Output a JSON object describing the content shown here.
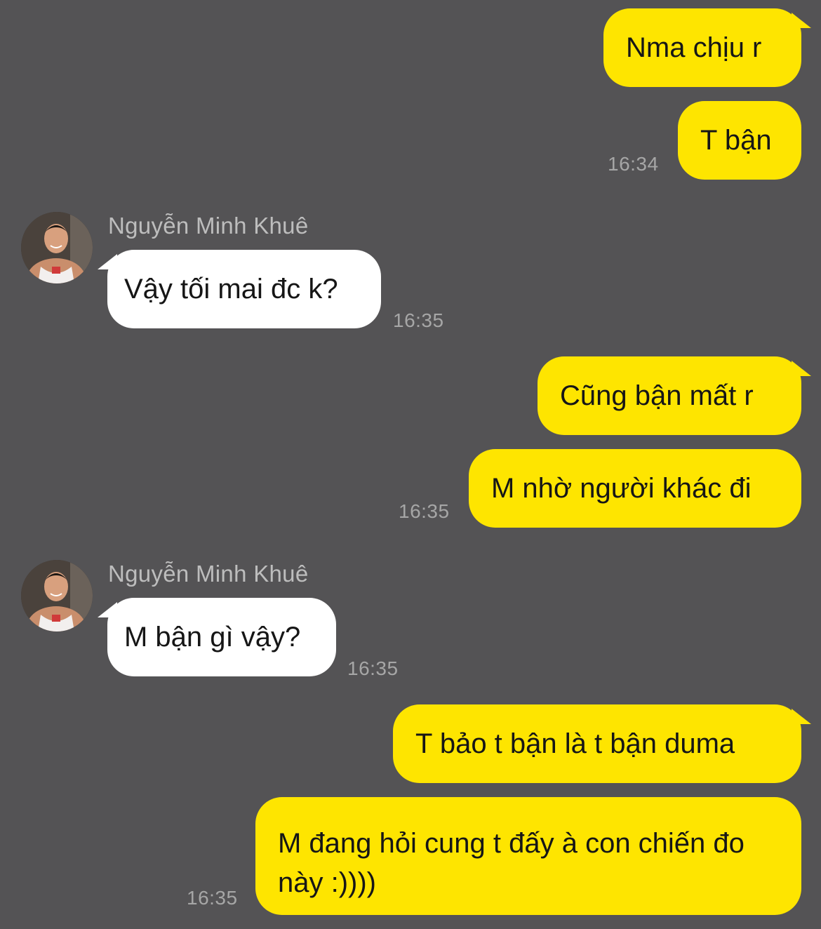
{
  "conversation": {
    "contact_name": "Nguyễn Minh Khuê",
    "avatar_icon": "person-photo-icon",
    "colors": {
      "background": "#545355",
      "outgoing_bubble": "#fee500",
      "incoming_bubble": "#ffffff",
      "timestamp": "#a6a6a6",
      "sender_name": "#bdbdbd"
    },
    "messages": [
      {
        "direction": "outgoing",
        "text": "Nma chịu r",
        "time": ""
      },
      {
        "direction": "outgoing",
        "text": "T bận",
        "time": "16:34"
      },
      {
        "direction": "incoming",
        "sender": "Nguyễn Minh Khuê",
        "text": "Vậy tối mai đc k?",
        "time": "16:35"
      },
      {
        "direction": "outgoing",
        "text": "Cũng bận mất r",
        "time": ""
      },
      {
        "direction": "outgoing",
        "text": "M nhờ người khác đi",
        "time": "16:35"
      },
      {
        "direction": "incoming",
        "sender": "Nguyễn Minh Khuê",
        "text": "M bận gì vậy?",
        "time": "16:35"
      },
      {
        "direction": "outgoing",
        "text": "T bảo t bận là t bận duma",
        "time": ""
      },
      {
        "direction": "outgoing",
        "text": "M đang hỏi cung t đấy à con chiến đo này :))))",
        "time": "16:35"
      }
    ]
  }
}
